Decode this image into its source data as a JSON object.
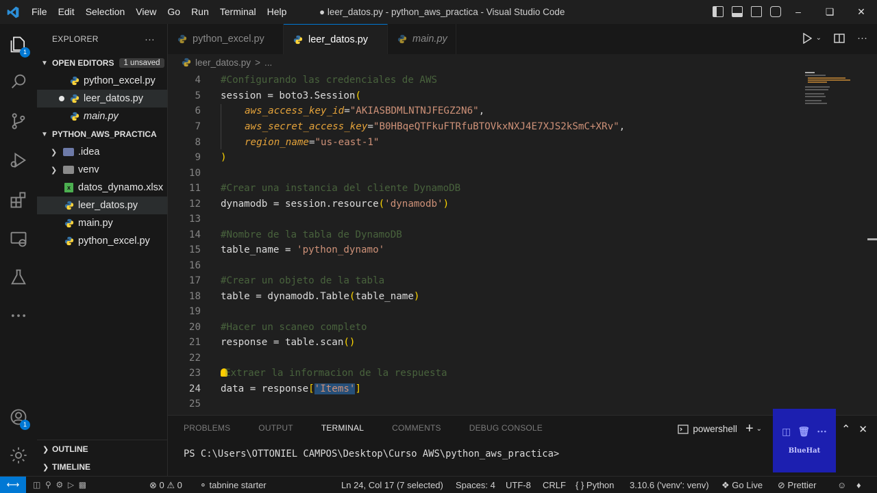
{
  "titlebar": {
    "menu": [
      "File",
      "Edit",
      "Selection",
      "View",
      "Go",
      "Run",
      "Terminal",
      "Help"
    ],
    "title": "● leer_datos.py - python_aws_practica - Visual Studio Code"
  },
  "activity": {
    "explorer_badge": "1",
    "accounts_badge": "1"
  },
  "sidebar": {
    "header": "EXPLORER",
    "more": "···",
    "open_editors": {
      "label": "OPEN EDITORS",
      "badge": "1 unsaved",
      "files": [
        "python_excel.py",
        "leer_datos.py",
        "main.py"
      ]
    },
    "project": {
      "label": "PYTHON_AWS_PRACTICA",
      "items": [
        ".idea",
        "venv",
        "datos_dynamo.xlsx",
        "leer_datos.py",
        "main.py",
        "python_excel.py"
      ]
    },
    "outline": "OUTLINE",
    "timeline": "TIMELINE"
  },
  "tabs": [
    "python_excel.py",
    "leer_datos.py",
    "main.py"
  ],
  "breadcrumb": {
    "file": "leer_datos.py",
    "sep": ">",
    "rest": "..."
  },
  "editor": {
    "line_numbers": [
      "4",
      "5",
      "6",
      "7",
      "8",
      "9",
      "10",
      "11",
      "12",
      "13",
      "14",
      "15",
      "16",
      "17",
      "18",
      "19",
      "20",
      "21",
      "22",
      "23",
      "24",
      "25"
    ],
    "l4": "#Configurando las credenciales de AWS",
    "l5_a": "session",
    "l5_b": " = boto3.Session",
    "l5_c": "(",
    "l6_key": "aws_access_key_id",
    "l6_val": "\"AKIASBDMLNTNJFEGZ2N6\"",
    "l7_key": "aws_secret_access_key",
    "l7_val": "\"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\"",
    "l8_key": "region_name",
    "l8_val": "\"us-east-1\"",
    "l9": ")",
    "l11": "#Crear una instancia del cliente DynamoDB",
    "l12_a": "dynamodb = session.resource",
    "l12_str": "'dynamodb'",
    "l14": "#Nombre de la tabla de DynamoDB",
    "l15_a": "table_name = ",
    "l15_str": "'python_dynamo'",
    "l17": "#Crear un objeto de la tabla",
    "l18_a": "table = dynamodb.Table",
    "l18_arg": "table_name",
    "l20": "#Hacer un scaneo completo",
    "l21": "response = table.scan",
    "l21_p": "()",
    "l23": "Extraer la informacion de la respuesta",
    "l24_a": "data = response",
    "l24_str": "'Items'"
  },
  "panel": {
    "tabs": [
      "PROBLEMS",
      "OUTPUT",
      "TERMINAL",
      "COMMENTS",
      "DEBUG CONSOLE"
    ],
    "active_tab": "TERMINAL",
    "shell": "powershell",
    "prompt": "PS C:\\Users\\OTTONIEL CAMPOS\\Desktop\\Curso AWS\\python_aws_practica>",
    "watermark": "BlueHat"
  },
  "status": {
    "errors": "0",
    "warnings": "0",
    "tabnine": "tabnine starter",
    "position": "Ln 24, Col 17 (7 selected)",
    "spaces": "Spaces: 4",
    "encoding": "UTF-8",
    "eol": "CRLF",
    "language": "Python",
    "interpreter": "3.10.6 ('venv': venv)",
    "golive": "Go Live",
    "prettier": "Prettier"
  },
  "colors": {
    "accent": "#0078d4",
    "python_blue": "#3572a5",
    "python_yellow": "#ffd43b",
    "string": "#ce9178",
    "parameter": "#e5a33a",
    "comment": "#6a9955"
  }
}
